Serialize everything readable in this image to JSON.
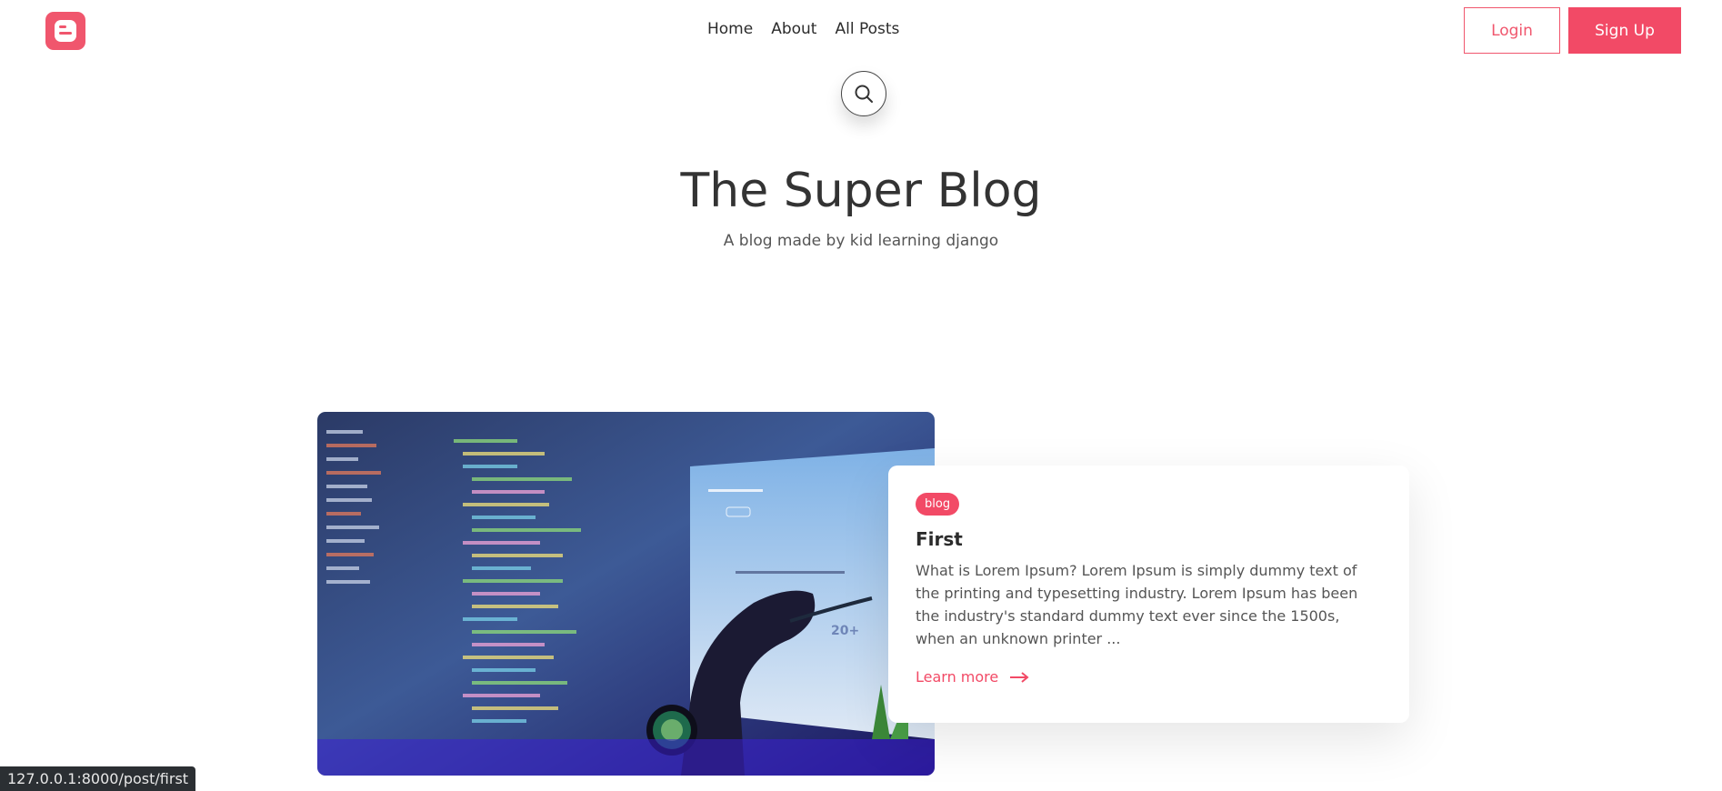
{
  "header": {
    "logo_icon": "blogger-logo-icon",
    "nav": [
      {
        "label": "Home"
      },
      {
        "label": "About"
      },
      {
        "label": "All Posts"
      }
    ],
    "login_label": "Login",
    "signup_label": "Sign Up"
  },
  "search": {
    "icon": "search-icon"
  },
  "hero": {
    "title": "The Super Blog",
    "subtitle": "A blog made by kid learning django"
  },
  "post": {
    "image_alt": "code-on-monitor-photo",
    "tag": "blog",
    "title": "First",
    "excerpt": "What is Lorem Ipsum? Lorem Ipsum is simply dummy text of the printing and typesetting industry. Lorem Ipsum has been the industry's standard dummy text ever since the 1500s, when an unknown printer ...",
    "learn_more": "Learn more"
  },
  "status_bar": {
    "url": "127.0.0.1:8000/post/first"
  },
  "colors": {
    "accent": "#f24a66",
    "text": "#2b2b2b",
    "muted": "#555555"
  }
}
